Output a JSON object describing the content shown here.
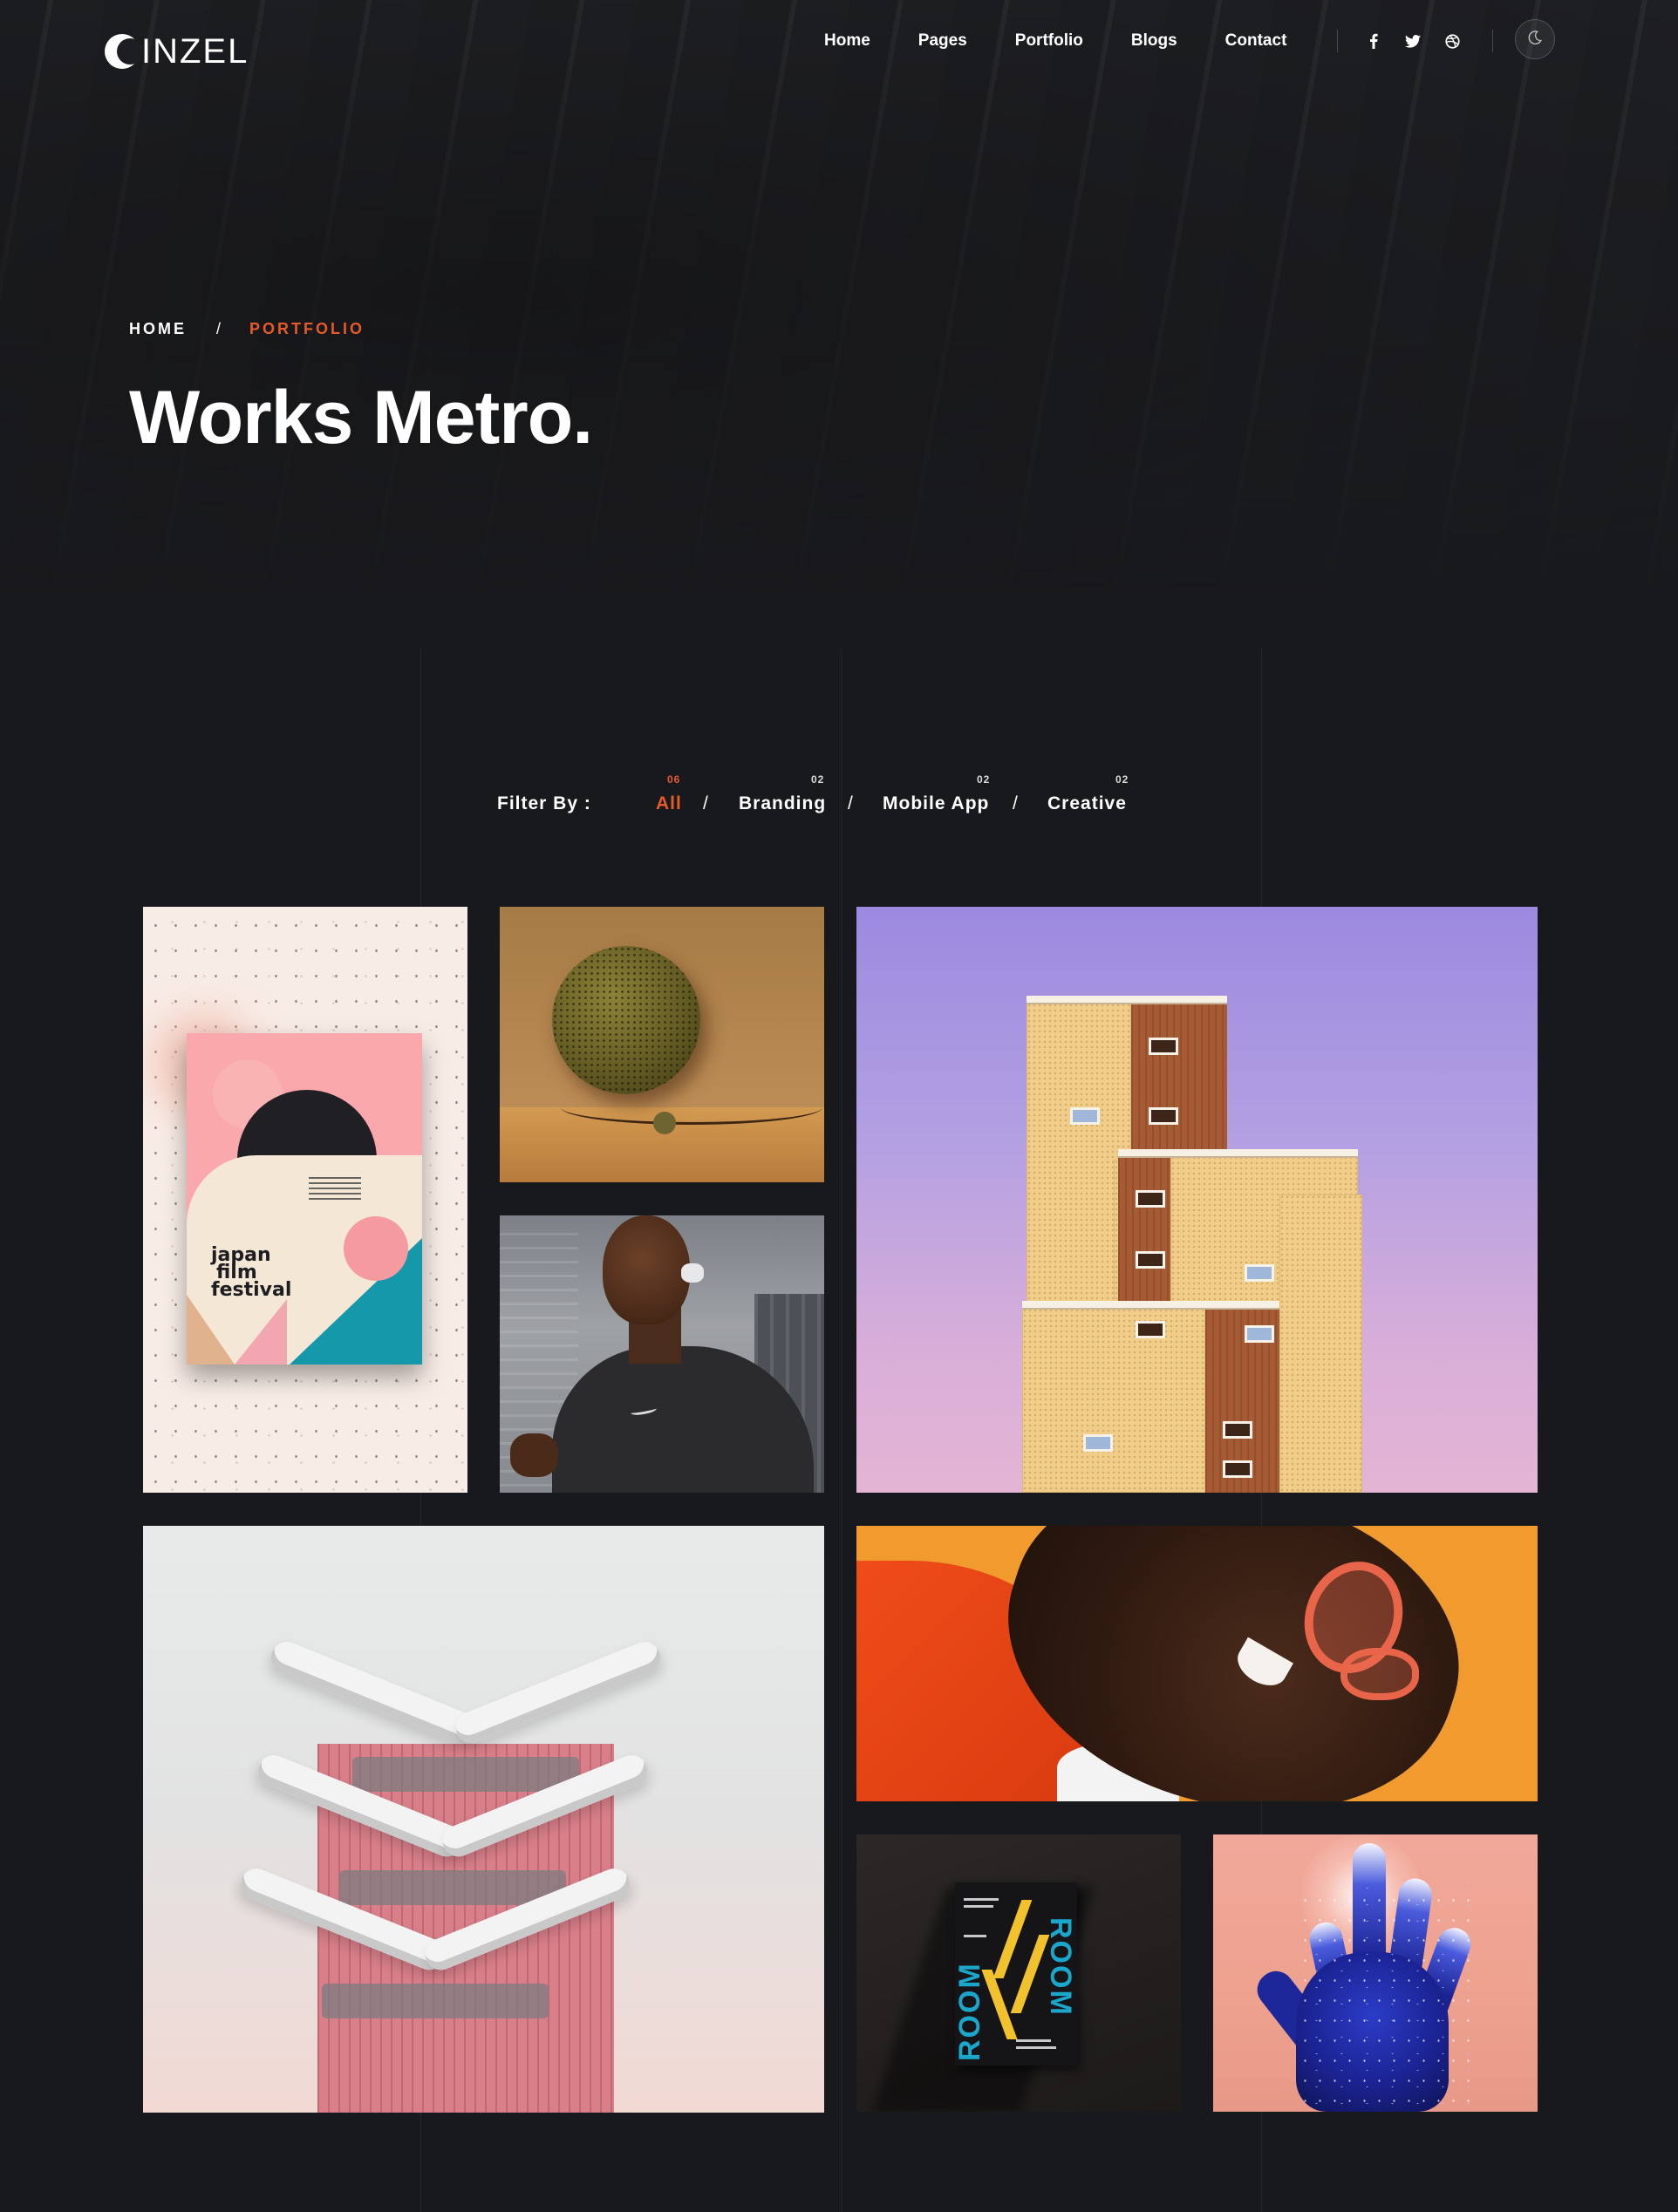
{
  "header": {
    "logo_text": "INZEL",
    "nav": [
      "Home",
      "Pages",
      "Portfolio",
      "Blogs",
      "Contact"
    ],
    "social_icons": [
      "facebook-icon",
      "twitter-icon",
      "dribbble-icon"
    ],
    "theme_toggle_icon": "moon-icon"
  },
  "hero": {
    "breadcrumb_home": "HOME",
    "breadcrumb_sep": "/",
    "breadcrumb_current": "PORTFOLIO",
    "title": "Works Metro."
  },
  "filter": {
    "label": "Filter By :",
    "items": [
      {
        "label": "All",
        "count": "06",
        "active": true
      },
      {
        "label": "Branding",
        "count": "02",
        "active": false
      },
      {
        "label": "Mobile App",
        "count": "02",
        "active": false
      },
      {
        "label": "Creative",
        "count": "02",
        "active": false
      }
    ],
    "sep": "/"
  },
  "poster": {
    "text_line1": "japan",
    "text_line2": "film",
    "text_line3": "festival"
  },
  "book": {
    "word": "ROOM"
  },
  "colors": {
    "accent": "#e45a2b",
    "background": "#18191c"
  }
}
